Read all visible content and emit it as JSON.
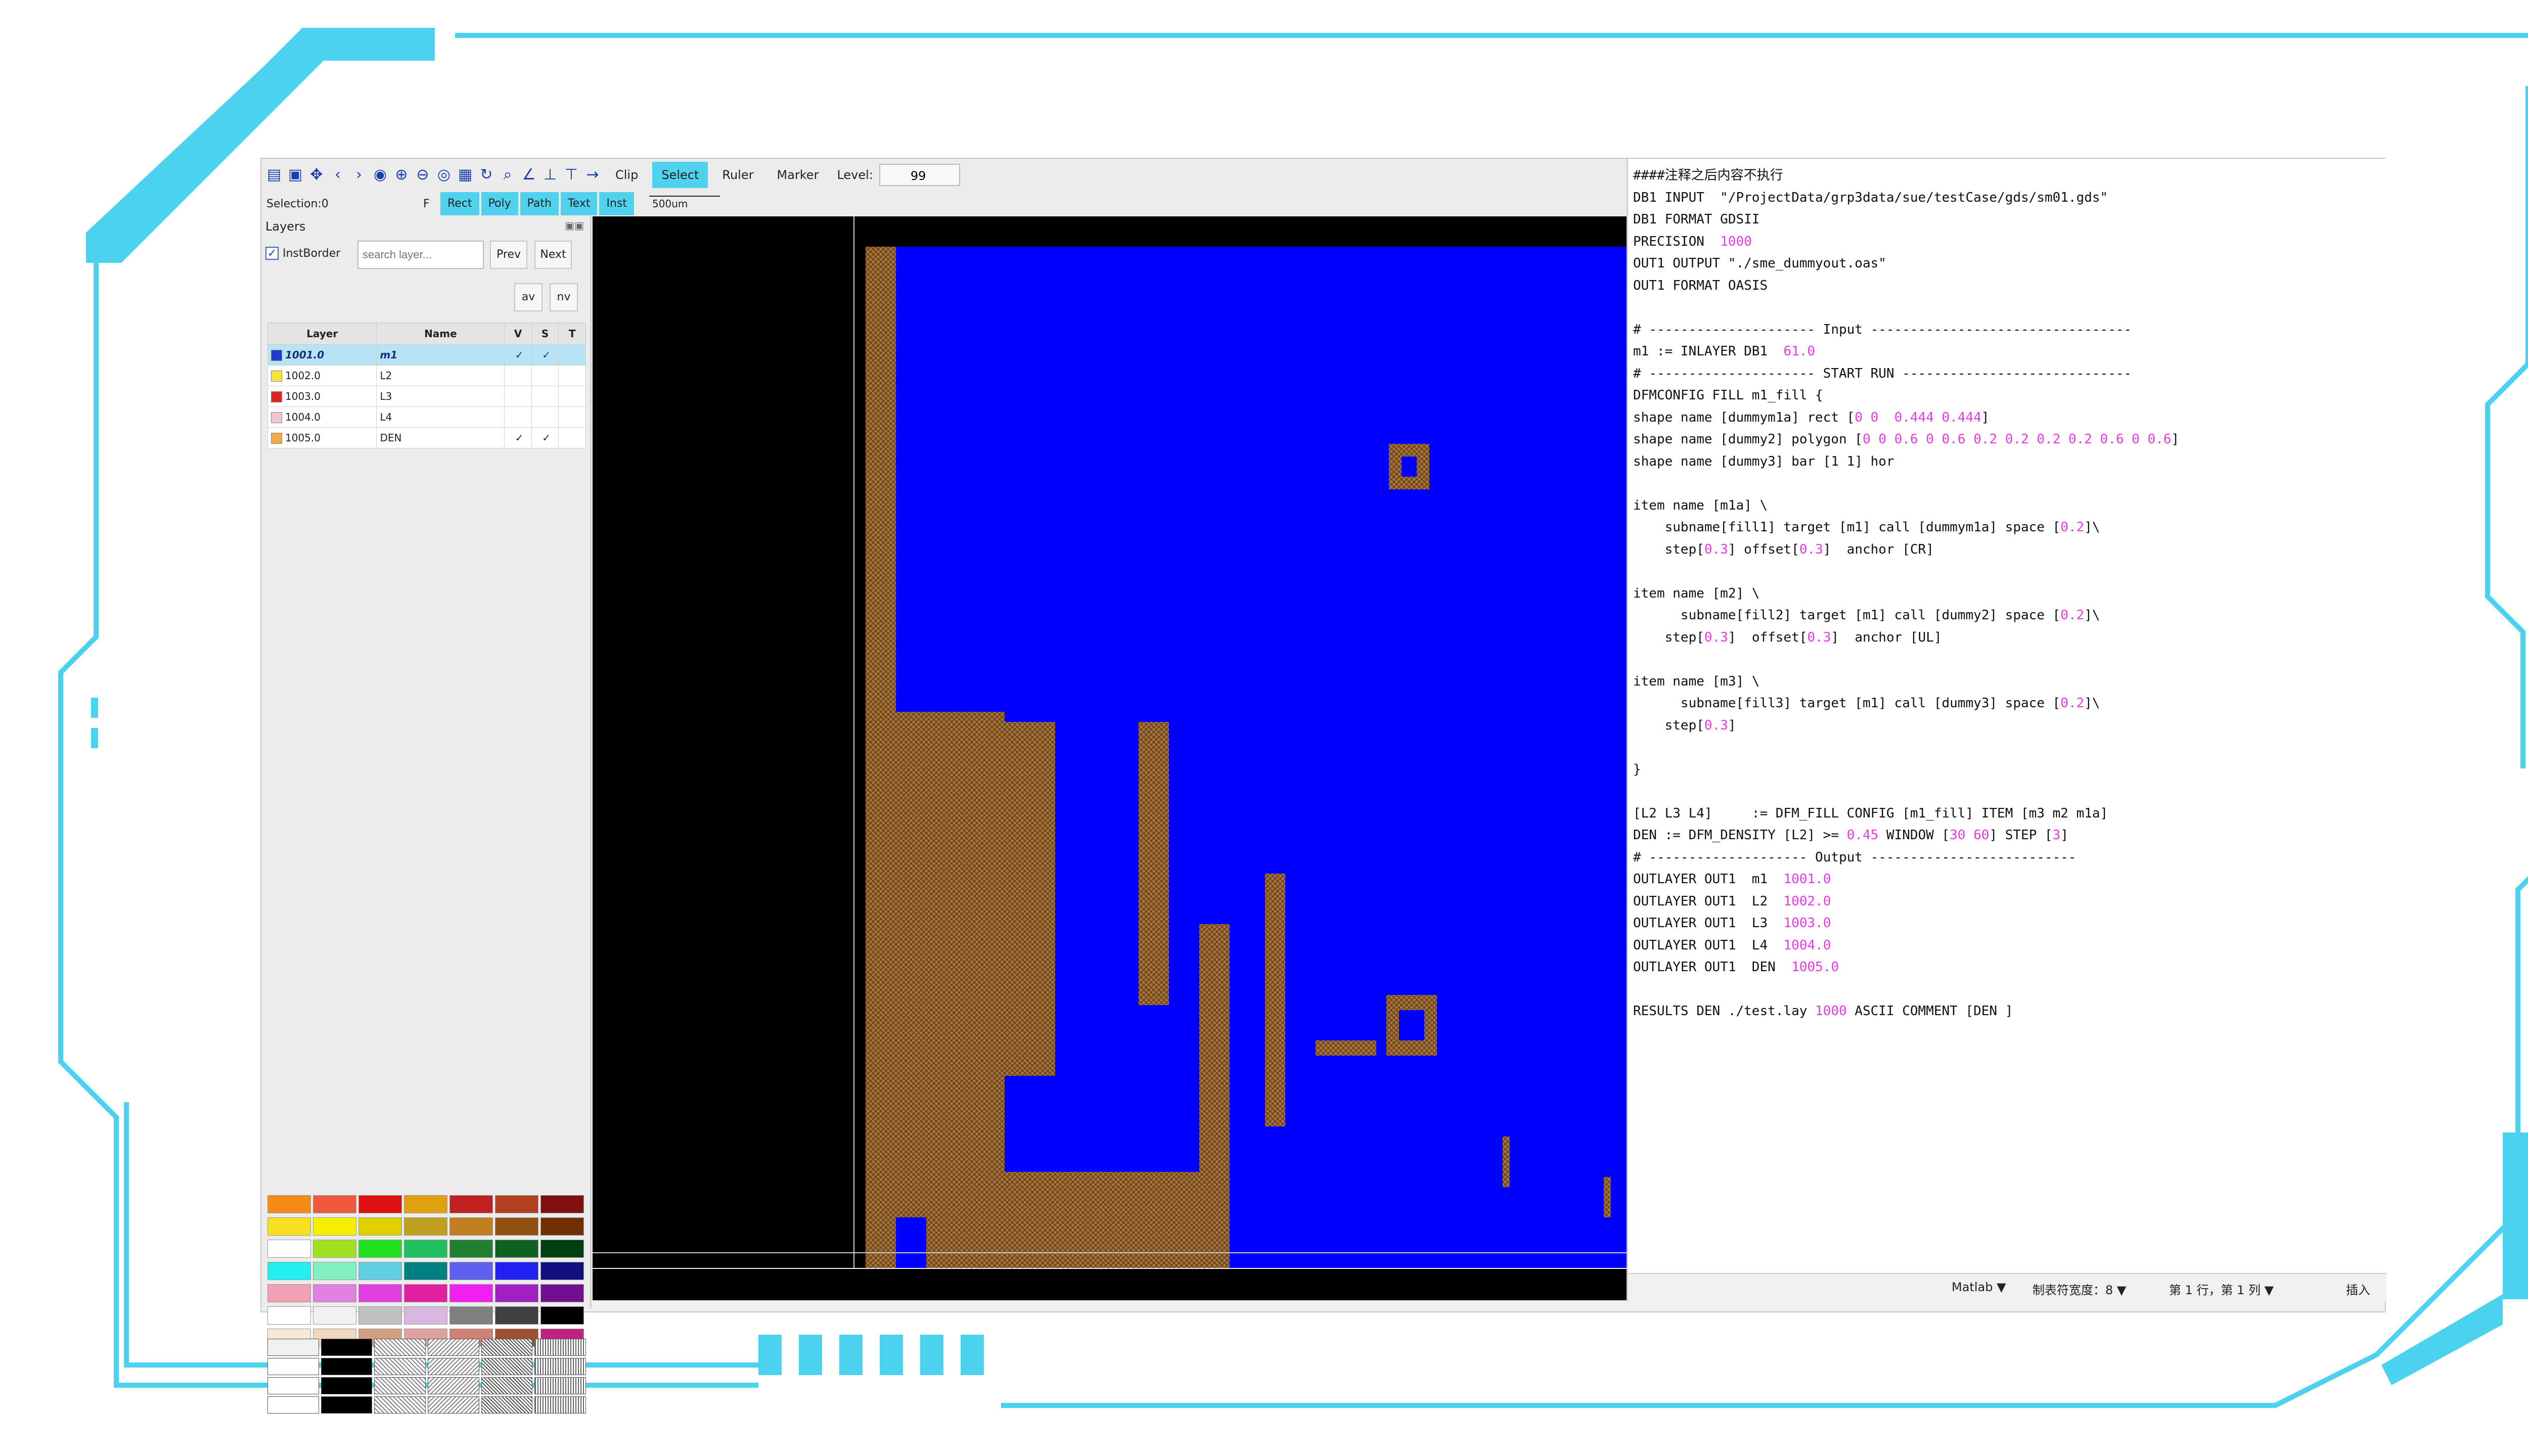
{
  "toolbar": {
    "icons": [
      "save-icon",
      "open-icon",
      "move-icon",
      "prev-icon",
      "next-icon",
      "zoom-fit-icon",
      "zoom-in-icon",
      "zoom-out-icon",
      "eye-icon",
      "grid-icon",
      "refresh-icon",
      "search-icon",
      "angle-icon",
      "perpendicular-icon",
      "text-t-icon",
      "arrow-right-icon"
    ],
    "clip": "Clip",
    "select": "Select",
    "ruler": "Ruler",
    "marker": "Marker",
    "level_label": "Level:",
    "level_value": "99"
  },
  "toolbar2": {
    "selection": "Selection:0",
    "f": "F",
    "buttons": [
      "Rect",
      "Poly",
      "Path",
      "Text",
      "Inst"
    ],
    "scale": "500um"
  },
  "layers_panel": {
    "title": "Layers",
    "instborder": "InstBorder",
    "search_placeholder": "search layer...",
    "prev": "Prev",
    "next": "Next",
    "av": "av",
    "nv": "nv",
    "columns": [
      "Layer",
      "Name",
      "V",
      "S",
      "T"
    ],
    "rows": [
      {
        "layer": "1001.0",
        "name": "m1",
        "v": "✓",
        "s": "✓",
        "t": "",
        "color": "#1f3ad0",
        "selected": true
      },
      {
        "layer": "1002.0",
        "name": "L2",
        "v": "",
        "s": "",
        "t": "",
        "color": "#f5e23a",
        "selected": false
      },
      {
        "layer": "1003.0",
        "name": "L3",
        "v": "",
        "s": "",
        "t": "",
        "color": "#e02424",
        "selected": false
      },
      {
        "layer": "1004.0",
        "name": "L4",
        "v": "",
        "s": "",
        "t": "",
        "color": "#f6c3d2",
        "selected": false
      },
      {
        "layer": "1005.0",
        "name": "DEN",
        "v": "✓",
        "s": "✓",
        "t": "",
        "color": "#f5a84a",
        "selected": false
      }
    ],
    "palette": [
      [
        "#f58a14",
        "#f05a3c",
        "#e01010",
        "#e0a010",
        "#c02020",
        "#b04020",
        "#801010"
      ],
      [
        "#f8e020",
        "#f4f000",
        "#e0d000",
        "#c0a020",
        "#c08020",
        "#905010",
        "#703000"
      ],
      [
        "#ffffff",
        "#a0e020",
        "#20e020",
        "#20c060",
        "#208030",
        "#106020",
        "#004010"
      ],
      [
        "#20f0f0",
        "#80f0c0",
        "#60d0e0",
        "#008080",
        "#6060f0",
        "#2020f0",
        "#101080"
      ],
      [
        "#f0a0b0",
        "#e080e0",
        "#e040e0",
        "#e020a0",
        "#f020f0",
        "#a020c0",
        "#701090"
      ],
      [
        "#ffffff",
        "#f0f0f0",
        "#c0c0c0",
        "#d8b8e0",
        "#808080",
        "#404040",
        "#000000"
      ],
      [
        "#f8e8d8",
        "#f0d8c0",
        "#d0a080",
        "#e0a0a0",
        "#d08070",
        "#a05030",
        "#c02080"
      ]
    ]
  },
  "editor": {
    "lines": [
      [
        {
          "t": "####注释之后内容不执行"
        }
      ],
      [
        {
          "t": "DB1 INPUT  \"/ProjectData/grp3data/sue/testCase/gds/sm01.gds\""
        }
      ],
      [
        {
          "t": "DB1 FORMAT GDSII"
        }
      ],
      [
        {
          "t": "PRECISION  "
        },
        {
          "t": "1000",
          "n": 1
        }
      ],
      [
        {
          "t": "OUT1 OUTPUT \"./sme_dummyout.oas\""
        }
      ],
      [
        {
          "t": "OUT1 FORMAT OASIS"
        }
      ],
      [
        {
          "t": ""
        }
      ],
      [
        {
          "t": "# --------------------- Input ---------------------------------"
        }
      ],
      [
        {
          "t": "m1 := INLAYER DB1  "
        },
        {
          "t": "61.0",
          "n": 1
        }
      ],
      [
        {
          "t": "# --------------------- START RUN -----------------------------"
        }
      ],
      [
        {
          "t": "DFMCONFIG FILL m1_fill {"
        }
      ],
      [
        {
          "t": "shape name [dummym1a] rect ["
        },
        {
          "t": "0 0  0.444 0.444",
          "n": 1
        },
        {
          "t": "]"
        }
      ],
      [
        {
          "t": "shape name [dummy2] polygon ["
        },
        {
          "t": "0 0 0.6 0 0.6 0.2 0.2 0.2 0.2 0.6 0 0.6",
          "n": 1
        },
        {
          "t": "]"
        }
      ],
      [
        {
          "t": "shape name [dummy3] bar [1 1] hor"
        }
      ],
      [
        {
          "t": ""
        }
      ],
      [
        {
          "t": "item name [m1a] \\"
        }
      ],
      [
        {
          "t": "    subname[fill1] target [m1] call [dummym1a] space ["
        },
        {
          "t": "0.2",
          "n": 1
        },
        {
          "t": "]\\"
        }
      ],
      [
        {
          "t": "    step["
        },
        {
          "t": "0.3",
          "n": 1
        },
        {
          "t": "] offset["
        },
        {
          "t": "0.3",
          "n": 1
        },
        {
          "t": "]  anchor [CR]"
        }
      ],
      [
        {
          "t": ""
        }
      ],
      [
        {
          "t": "item name [m2] \\"
        }
      ],
      [
        {
          "t": "      subname[fill2] target [m1] call [dummy2] space ["
        },
        {
          "t": "0.2",
          "n": 1
        },
        {
          "t": "]\\"
        }
      ],
      [
        {
          "t": "    step["
        },
        {
          "t": "0.3",
          "n": 1
        },
        {
          "t": "]  offset["
        },
        {
          "t": "0.3",
          "n": 1
        },
        {
          "t": "]  anchor [UL]"
        }
      ],
      [
        {
          "t": ""
        }
      ],
      [
        {
          "t": "item name [m3] \\"
        }
      ],
      [
        {
          "t": "      subname[fill3] target [m1] call [dummy3] space ["
        },
        {
          "t": "0.2",
          "n": 1
        },
        {
          "t": "]\\"
        }
      ],
      [
        {
          "t": "    step["
        },
        {
          "t": "0.3",
          "n": 1
        },
        {
          "t": "]"
        }
      ],
      [
        {
          "t": ""
        }
      ],
      [
        {
          "t": "}"
        }
      ],
      [
        {
          "t": ""
        }
      ],
      [
        {
          "t": "[L2 L3 L4]     := DFM_FILL CONFIG [m1_fill] ITEM [m3 m2 m1a]"
        }
      ],
      [
        {
          "t": "DEN := DFM_DENSITY [L2] >= "
        },
        {
          "t": "0.45",
          "n": 1
        },
        {
          "t": " WINDOW ["
        },
        {
          "t": "30 60",
          "n": 1
        },
        {
          "t": "] STEP ["
        },
        {
          "t": "3",
          "n": 1
        },
        {
          "t": "]"
        }
      ],
      [
        {
          "t": "# -------------------- Output --------------------------"
        }
      ],
      [
        {
          "t": "OUTLAYER OUT1  m1  "
        },
        {
          "t": "1001.0",
          "n": 1
        }
      ],
      [
        {
          "t": "OUTLAYER OUT1  L2  "
        },
        {
          "t": "1002.0",
          "n": 1
        }
      ],
      [
        {
          "t": "OUTLAYER OUT1  L3  "
        },
        {
          "t": "1003.0",
          "n": 1
        }
      ],
      [
        {
          "t": "OUTLAYER OUT1  L4  "
        },
        {
          "t": "1004.0",
          "n": 1
        }
      ],
      [
        {
          "t": "OUTLAYER OUT1  DEN  "
        },
        {
          "t": "1005.0",
          "n": 1
        }
      ],
      [
        {
          "t": ""
        }
      ],
      [
        {
          "t": "RESULTS DEN ./test.lay "
        },
        {
          "t": "1000",
          "n": 1
        },
        {
          "t": " ASCII COMMENT [DEN ]"
        }
      ]
    ],
    "status": {
      "language": "Matlab ▼",
      "tab_width": "制表符宽度：8 ▼",
      "position": "第 1 行，第 1 列 ▼",
      "mode": "插入"
    }
  },
  "colors": {
    "frame_cyan": "#4ad2ee",
    "canvas_blue": "#0000ff",
    "fill_brown": "#a8743a",
    "accent": "#4fd2ee"
  }
}
